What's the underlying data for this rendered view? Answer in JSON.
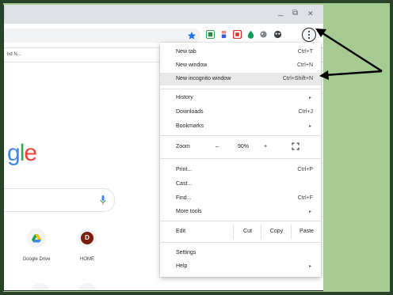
{
  "window": {
    "controls": {
      "minimize": "_",
      "restore": "⧉",
      "close": "✕"
    }
  },
  "bookmarks": {
    "item_label": "nd N..."
  },
  "newtab": {
    "logo_text": "gle",
    "shortcuts": [
      {
        "label": "Google Drive",
        "icon": "google-drive-icon"
      },
      {
        "label": "HOME",
        "letter": "D",
        "color": "#7a1f0e"
      }
    ]
  },
  "menu": {
    "new_tab": {
      "label": "New tab",
      "shortcut": "Ctrl+T"
    },
    "new_window": {
      "label": "New window",
      "shortcut": "Ctrl+N"
    },
    "new_incognito": {
      "label": "New incognito window",
      "shortcut": "Ctrl+Shift+N"
    },
    "history": {
      "label": "History",
      "arrow": "▸"
    },
    "downloads": {
      "label": "Downloads",
      "shortcut": "Ctrl+J"
    },
    "bookmarks": {
      "label": "Bookmarks",
      "arrow": "▸"
    },
    "zoom": {
      "label": "Zoom",
      "minus": "–",
      "value": "90%",
      "plus": "+",
      "fullscreen_icon": "fullscreen-icon"
    },
    "print": {
      "label": "Print...",
      "shortcut": "Ctrl+P"
    },
    "cast": {
      "label": "Cast..."
    },
    "find": {
      "label": "Find...",
      "shortcut": "Ctrl+F"
    },
    "more_tools": {
      "label": "More tools",
      "arrow": "▸"
    },
    "edit": {
      "label": "Edit",
      "cut": "Cut",
      "copy": "Copy",
      "paste": "Paste"
    },
    "settings": {
      "label": "Settings"
    },
    "help": {
      "label": "Help",
      "arrow": "▸"
    }
  },
  "colors": {
    "outer_background": "#a6cb92",
    "frame_border": "#29422a",
    "menu_highlight": "#e8e8e9",
    "star": "#1a73e8"
  }
}
